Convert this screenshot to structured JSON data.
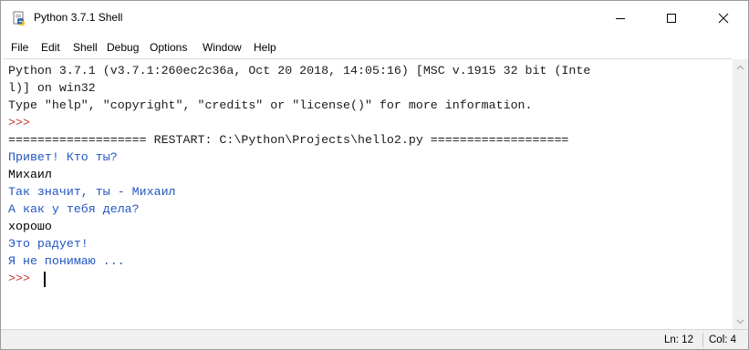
{
  "window": {
    "title": "Python 3.7.1 Shell",
    "icon": "python-idle-icon"
  },
  "window_controls": {
    "minimize_icon": "minimize-icon",
    "maximize_icon": "maximize-icon",
    "close_icon": "close-icon"
  },
  "menu": {
    "items": [
      "File",
      "Edit",
      "Shell",
      "Debug",
      "Options",
      "Window",
      "Help"
    ]
  },
  "shell": {
    "lines": [
      {
        "text": "Python 3.7.1 (v3.7.1:260ec2c36a, Oct 20 2018, 14:05:16) [MSC v.1915 32 bit (Inte",
        "kind": "out"
      },
      {
        "text": "l)] on win32",
        "kind": "out"
      },
      {
        "text": "Type \"help\", \"copyright\", \"credits\" or \"license()\" for more information.",
        "kind": "out"
      },
      {
        "text": ">>> ",
        "kind": "prompt"
      },
      {
        "text": "=================== RESTART: C:\\Python\\Projects\\hello2.py ===================",
        "kind": "restart"
      },
      {
        "text": "Привет! Кто ты?",
        "kind": "prog"
      },
      {
        "text": "Михаил",
        "kind": "user"
      },
      {
        "text": "Так значит, ты - Михаил",
        "kind": "prog"
      },
      {
        "text": "А как у тебя дела?",
        "kind": "prog"
      },
      {
        "text": "хорошо",
        "kind": "user"
      },
      {
        "text": "Это радует!",
        "kind": "prog"
      },
      {
        "text": "Я не понимаю ...",
        "kind": "prog"
      },
      {
        "text": ">>> ",
        "kind": "prompt"
      }
    ]
  },
  "colors": {
    "output": "#1a1a1a",
    "prompt": "#c0392b",
    "program_output": "#2255c0",
    "user_input": "#000000"
  },
  "scrollbar": {
    "up_icon": "scroll-up-arrow-icon",
    "down_icon": "scroll-down-arrow-icon"
  },
  "status": {
    "line": "Ln: 12",
    "col": "Col: 4"
  }
}
